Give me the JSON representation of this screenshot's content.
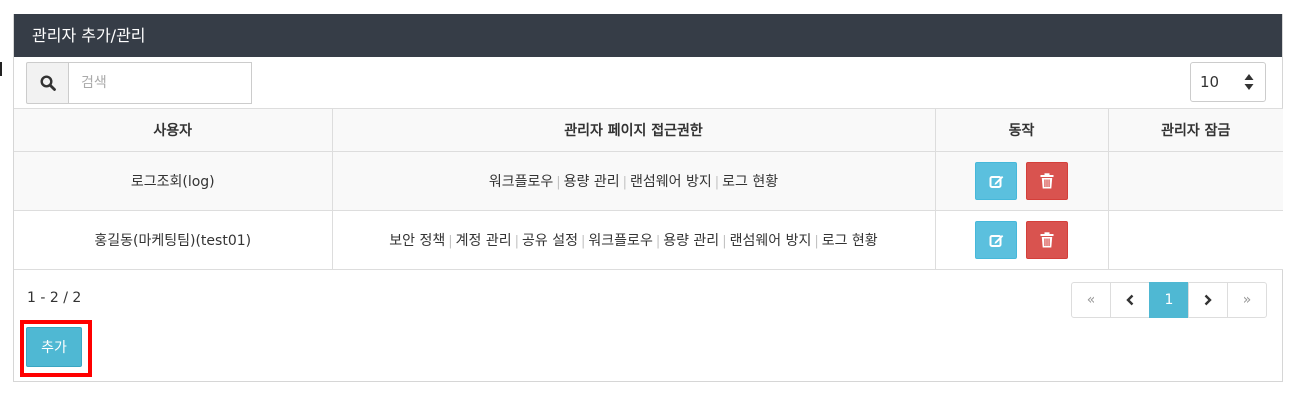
{
  "panel": {
    "title": "관리자 추가/관리"
  },
  "search": {
    "placeholder": "검색",
    "value": ""
  },
  "page_size": {
    "value": "10"
  },
  "table": {
    "headers": [
      "사용자",
      "관리자 페이지 접근권한",
      "동작",
      "관리자 잠금"
    ],
    "rows": [
      {
        "user": "로그조회(log)",
        "permissions": [
          "워크플로우",
          "용량 관리",
          "랜섬웨어 방지",
          "로그 현황"
        ],
        "lock": ""
      },
      {
        "user": "홍길동(마케팅팀)(test01)",
        "permissions": [
          "보안 정책",
          "계정 관리",
          "공유 설정",
          "워크플로우",
          "용량 관리",
          "랜섬웨어 방지",
          "로그 현황"
        ],
        "lock": ""
      }
    ]
  },
  "footer": {
    "info": "1 - 2 / 2",
    "pagination": {
      "first": "«",
      "prev": "‹",
      "current": "1",
      "next": "›",
      "last": "»"
    }
  },
  "actions": {
    "add_label": "추가"
  },
  "colors": {
    "header_bg": "#363d47",
    "accent": "#4fb8d3",
    "edit": "#5bc0de",
    "delete": "#d9534f",
    "highlight": "#ff0000"
  },
  "icons": {
    "search": "search-icon",
    "edit": "edit-icon",
    "delete": "trash-icon",
    "select": "sort-caret-icon"
  }
}
